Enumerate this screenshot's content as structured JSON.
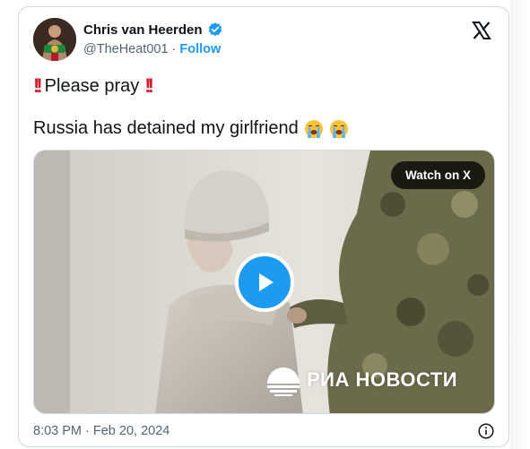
{
  "tweet": {
    "author_name": "Chris van Heerden",
    "handle": "@TheHeat001",
    "separator": "·",
    "follow_label": "Follow",
    "text_line1": "Please pray",
    "text_line2": "Russia has detained my girlfriend",
    "timestamp": "8:03 PM · Feb 20, 2024"
  },
  "media": {
    "watch_label": "Watch on X",
    "watermark_text": "РИА НОВОСТИ"
  },
  "icons": {
    "verified": "verified-badge-icon",
    "platform": "x-logo-icon",
    "emphasis": "double-exclamation-icon",
    "crying": "loudly-crying-face-icon",
    "play": "play-icon",
    "info": "info-icon"
  },
  "colors": {
    "accent": "#1d9bf0",
    "text": "#0f1419",
    "muted": "#536471",
    "alert_red": "#d01f2e"
  }
}
